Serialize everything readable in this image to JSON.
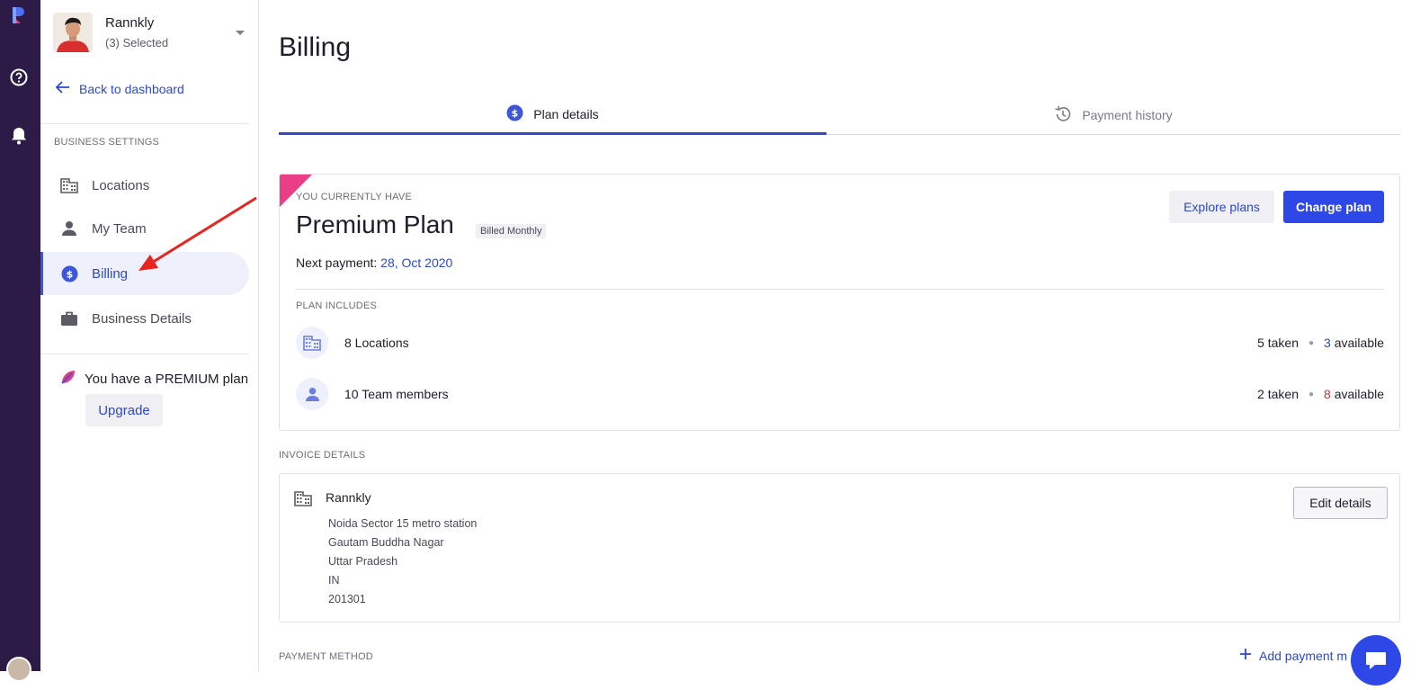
{
  "account": {
    "name": "Rannkly",
    "selected": "(3) Selected"
  },
  "sidebar": {
    "back": "Back to dashboard",
    "section": "BUSINESS SETTINGS",
    "items": [
      {
        "label": "Locations",
        "icon": "building-icon"
      },
      {
        "label": "My Team",
        "icon": "person-icon"
      },
      {
        "label": "Billing",
        "icon": "dollar-icon"
      },
      {
        "label": "Business Details",
        "icon": "briefcase-icon"
      }
    ],
    "plan_note": "You have a PREMIUM plan",
    "upgrade": "Upgrade"
  },
  "page": {
    "title": "Billing"
  },
  "tabs": [
    {
      "label": "Plan details",
      "icon": "dollar-icon"
    },
    {
      "label": "Payment history",
      "icon": "history-icon"
    }
  ],
  "plan": {
    "label": "YOU CURRENTLY HAVE",
    "name": "Premium Plan",
    "billed": "Billed Monthly",
    "next_label": "Next payment:",
    "next_date": "28, Oct 2020",
    "explore": "Explore plans",
    "change": "Change plan",
    "includes_label": "PLAN INCLUDES",
    "items": [
      {
        "label": "8 Locations",
        "taken": "5 taken",
        "available_num": "3",
        "available": "available"
      },
      {
        "label": "10 Team members",
        "taken": "2 taken",
        "available_num": "8",
        "available": "available"
      }
    ]
  },
  "invoice": {
    "label": "INVOICE DETAILS",
    "business": "Rannkly",
    "address": [
      "Noida Sector 15 metro station",
      "Gautam Buddha Nagar",
      "Uttar Pradesh",
      "IN",
      "201301"
    ],
    "edit": "Edit details"
  },
  "payment": {
    "label": "PAYMENT METHOD",
    "add": "Add payment m"
  },
  "colors": {
    "primary": "#2d48e6",
    "rail": "#2c1a47",
    "ribbon": "#ea3f86",
    "arrow": "#e8241f"
  }
}
